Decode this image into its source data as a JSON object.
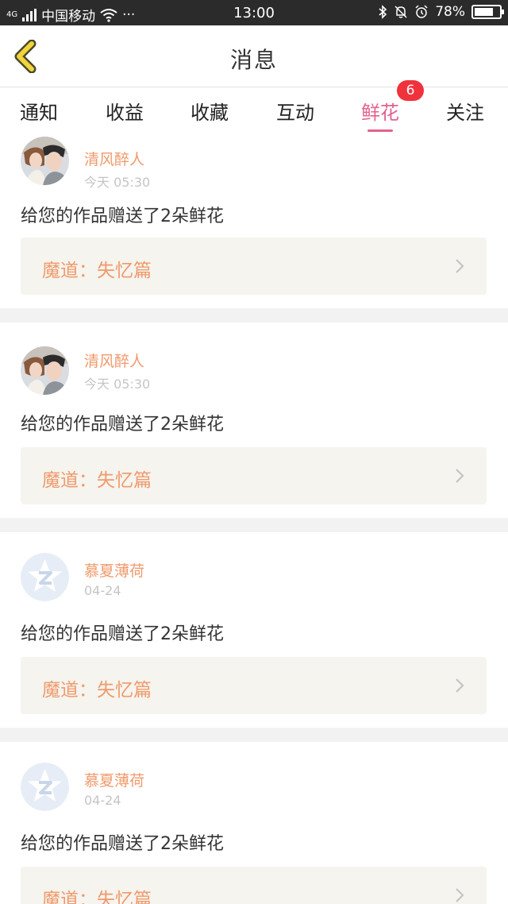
{
  "status_bar": {
    "network": "4G",
    "carrier": "中国移动",
    "more": "···",
    "time": "13:00",
    "battery_percent": "78%",
    "battery_level": 0.78
  },
  "header": {
    "title": "消息",
    "back_icon": "chevron-left-icon"
  },
  "tabs": [
    {
      "label": "通知",
      "active": false
    },
    {
      "label": "收益",
      "active": false
    },
    {
      "label": "收藏",
      "active": false
    },
    {
      "label": "互动",
      "active": false
    },
    {
      "label": "鲜花",
      "active": true,
      "badge": "6"
    },
    {
      "label": "关注",
      "active": false
    }
  ],
  "messages": [
    {
      "name": "清风醉人",
      "time": "今天 05:30",
      "text": "给您的作品赠送了2朵鲜花",
      "work": "魔道：失忆篇",
      "avatar": "photo-avatar"
    },
    {
      "name": "清风醉人",
      "time": "今天 05:30",
      "text": "给您的作品赠送了2朵鲜花",
      "work": "魔道：失忆篇",
      "avatar": "photo-avatar"
    },
    {
      "name": "慕夏薄荷",
      "time": "04-24",
      "text": "给您的作品赠送了2朵鲜花",
      "work": "魔道：失忆篇",
      "avatar": "default-avatar"
    },
    {
      "name": "慕夏薄荷",
      "time": "04-24",
      "text": "给您的作品赠送了2朵鲜花",
      "work": "魔道：失忆篇",
      "avatar": "default-avatar"
    }
  ],
  "colors": {
    "accent_pink": "#e4608f",
    "orange_text": "#f09a6c",
    "badge_red": "#f0323c",
    "work_bg": "#f5f4ee",
    "separator_bg": "#f2f2f2"
  }
}
